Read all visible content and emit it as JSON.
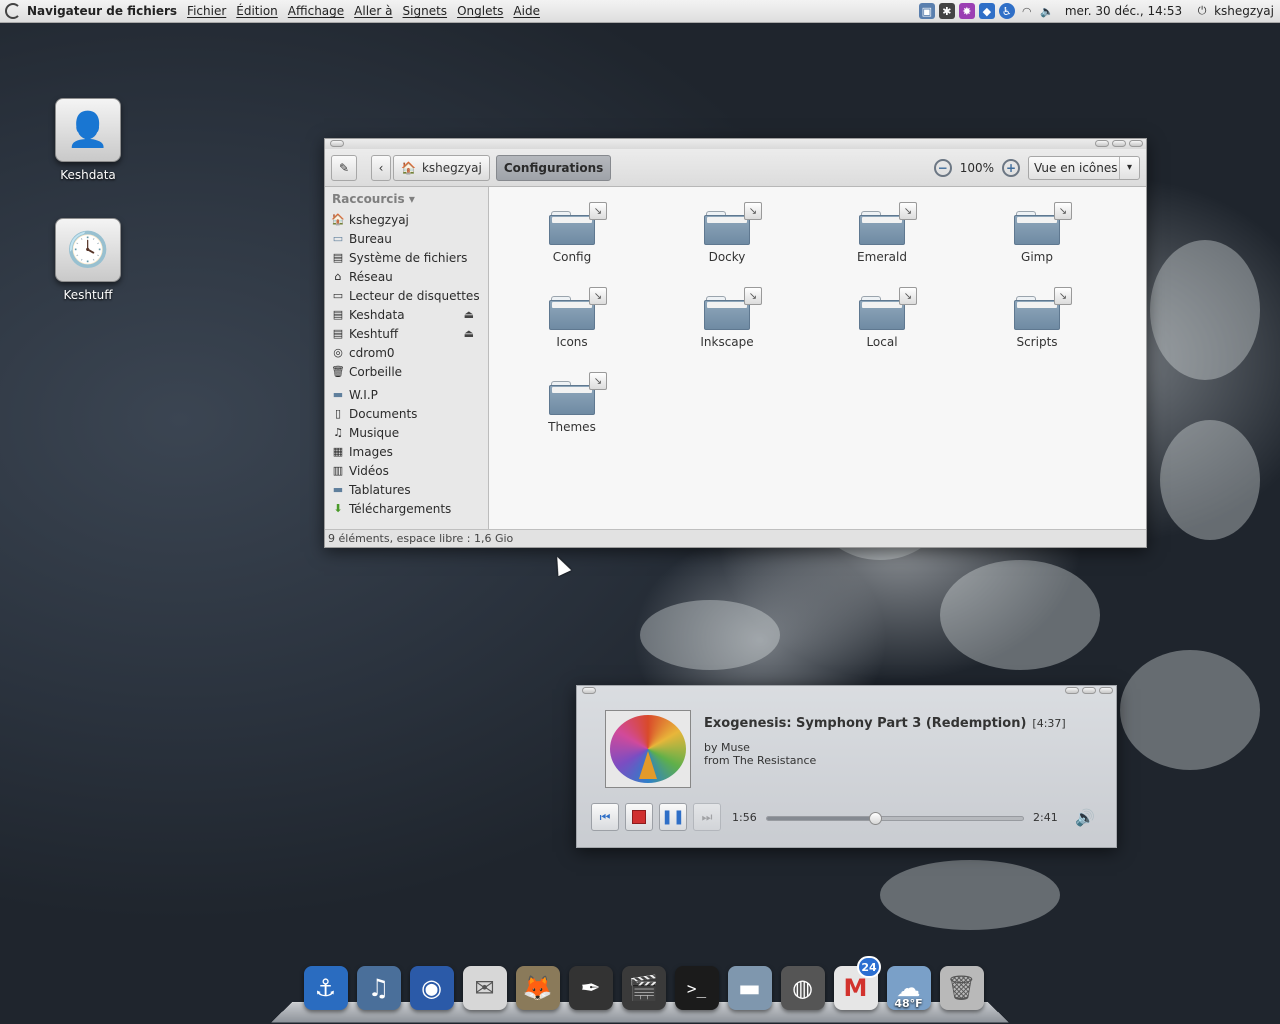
{
  "top_panel": {
    "app_name": "Navigateur de fichiers",
    "menus": [
      "Fichier",
      "Édition",
      "Affichage",
      "Aller à",
      "Signets",
      "Onglets",
      "Aide"
    ],
    "clock": "mer. 30 déc., 14:53",
    "user": "kshegzyaj",
    "tray_icons": [
      "display-icon",
      "fan-icon",
      "settings-gear-icon",
      "blue-app-icon",
      "accessibility-icon",
      "wifi-icon",
      "volume-icon",
      "power-icon"
    ]
  },
  "desktop": {
    "icons": [
      {
        "label": "Keshdata",
        "icon": "user-drive-icon"
      },
      {
        "label": "Keshtuff",
        "icon": "backup-drive-icon"
      }
    ]
  },
  "file_manager": {
    "location_home": "kshegzyaj",
    "location_current": "Configurations",
    "zoom": "100%",
    "view_mode": "Vue en icônes",
    "sidebar_header": "Raccourcis",
    "places": [
      {
        "label": "kshegzyaj",
        "icon": "home-icon"
      },
      {
        "label": "Bureau",
        "icon": "desktop-icon"
      },
      {
        "label": "Système de fichiers",
        "icon": "harddisk-icon"
      },
      {
        "label": "Réseau",
        "icon": "network-icon"
      },
      {
        "label": "Lecteur de disquettes",
        "icon": "floppy-icon"
      },
      {
        "label": "Keshdata",
        "icon": "drive-icon",
        "eject": true
      },
      {
        "label": "Keshtuff",
        "icon": "drive-icon",
        "eject": true
      },
      {
        "label": "cdrom0",
        "icon": "cdrom-icon"
      },
      {
        "label": "Corbeille",
        "icon": "trash-icon"
      }
    ],
    "bookmarks": [
      {
        "label": "W.I.P",
        "icon": "folder-icon"
      },
      {
        "label": "Documents",
        "icon": "documents-icon"
      },
      {
        "label": "Musique",
        "icon": "music-icon"
      },
      {
        "label": "Images",
        "icon": "images-icon"
      },
      {
        "label": "Vidéos",
        "icon": "video-icon"
      },
      {
        "label": "Tablatures",
        "icon": "folder-icon"
      },
      {
        "label": "Téléchargements",
        "icon": "download-icon"
      }
    ],
    "folders": [
      "Config",
      "Docky",
      "Emerald",
      "Gimp",
      "Icons",
      "Inkscape",
      "Local",
      "Scripts",
      "Themes"
    ],
    "status": "9 éléments, espace libre : 1,6 Gio"
  },
  "player": {
    "title": "Exogenesis: Symphony Part 3 (Redemption)",
    "duration": "[4:37]",
    "artist_line": "by Muse",
    "album_line": "from The Resistance",
    "elapsed": "1:56",
    "remaining": "2:41",
    "progress_fraction": 0.42
  },
  "dock": {
    "items": [
      {
        "name": "anchor-app-icon",
        "color": "#2a6cc0"
      },
      {
        "name": "music-player-icon",
        "color": "#4a6f9a"
      },
      {
        "name": "web-browser-icon",
        "color": "#2b5aa8"
      },
      {
        "name": "mail-clock-icon",
        "color": "#d7d7d7"
      },
      {
        "name": "gimp-icon",
        "color": "#8a7a5a"
      },
      {
        "name": "inkscape-icon",
        "color": "#333333"
      },
      {
        "name": "video-editor-icon",
        "color": "#3a3a3a"
      },
      {
        "name": "terminal-icon",
        "color": "#1b1b1b"
      },
      {
        "name": "file-manager-icon",
        "color": "#7f97ae"
      },
      {
        "name": "speaker-icon",
        "color": "#555555"
      },
      {
        "name": "gmail-icon",
        "color": "#e6e6e6",
        "badge": "24"
      },
      {
        "name": "weather-icon",
        "color": "#7aa0c8",
        "temp": "48°F"
      },
      {
        "name": "trash-icon",
        "color": "#b9b9b9"
      }
    ]
  }
}
